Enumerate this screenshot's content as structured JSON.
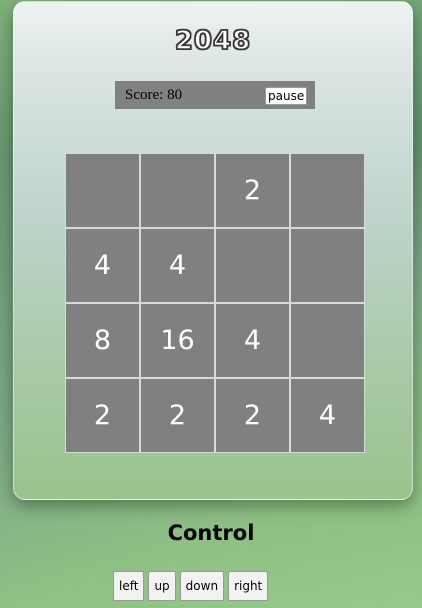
{
  "game": {
    "title": "2048",
    "score_label": "Score: 80",
    "pause_label": "pause"
  },
  "board": [
    [
      "",
      "",
      "2",
      ""
    ],
    [
      "4",
      "4",
      "",
      ""
    ],
    [
      "8",
      "16",
      "4",
      ""
    ],
    [
      "2",
      "2",
      "2",
      "4"
    ]
  ],
  "controls": {
    "heading": "Control",
    "buttons": [
      "left",
      "up",
      "down",
      "right"
    ]
  },
  "colors": {
    "tile": "#808080",
    "tile_text": "#ffffff",
    "scorebar": "#808080"
  }
}
